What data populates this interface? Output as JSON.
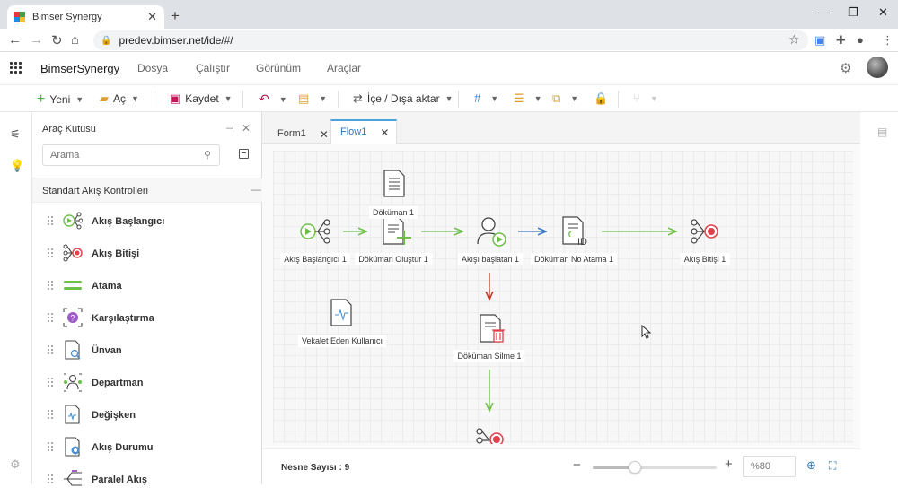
{
  "browser": {
    "tab_title": "Bimser Synergy",
    "url": "predev.bimser.net/ide/#/"
  },
  "app": {
    "brand": "BimserSynergy",
    "menus": [
      "Dosya",
      "Çalıştır",
      "Görünüm",
      "Araçlar"
    ]
  },
  "toolbar": {
    "new_label": "Yeni",
    "open_label": "Aç",
    "save_label": "Kaydet",
    "import_export_label": "İçe / Dışa aktar"
  },
  "toolbox": {
    "title": "Araç Kutusu",
    "search_placeholder": "Arama",
    "section_title": "Standart Akış Kontrolleri",
    "items": [
      {
        "label": "Akış Başlangıcı",
        "icon": "flow-start-icon"
      },
      {
        "label": "Akış Bitişi",
        "icon": "flow-end-icon"
      },
      {
        "label": "Atama",
        "icon": "assignment-icon"
      },
      {
        "label": "Karşılaştırma",
        "icon": "comparison-icon"
      },
      {
        "label": "Ünvan",
        "icon": "title-search-icon"
      },
      {
        "label": "Departman",
        "icon": "department-icon"
      },
      {
        "label": "Değişken",
        "icon": "variable-icon"
      },
      {
        "label": "Akış Durumu",
        "icon": "flow-status-icon"
      },
      {
        "label": "Paralel Akış",
        "icon": "parallel-flow-icon"
      }
    ]
  },
  "doc_tabs": [
    {
      "label": "Form1",
      "active": false
    },
    {
      "label": "Flow1",
      "active": true
    }
  ],
  "flow": {
    "nodes": {
      "start": "Akış Başlangıcı 1",
      "doc1": "Döküman 1",
      "doc_create": "Döküman Oluştur 1",
      "flow_started": "Akışı başlatan 1",
      "doc_no": "Döküman No Atama 1",
      "end": "Akış Bitişi 1",
      "proxy_user": "Vekalet Eden Kullanıcı",
      "doc_delete": "Döküman Silme 1"
    }
  },
  "status": {
    "object_count": "Nesne Sayısı : 9",
    "zoom_placeholder": "%80",
    "zoom_level": 0.34
  },
  "colors": {
    "accent_blue": "#2a78c5",
    "flow_green": "#6fbf4b",
    "flow_red": "#e0404a",
    "arrow_red": "#c0392b",
    "arrow_blue": "#3a78c9"
  }
}
